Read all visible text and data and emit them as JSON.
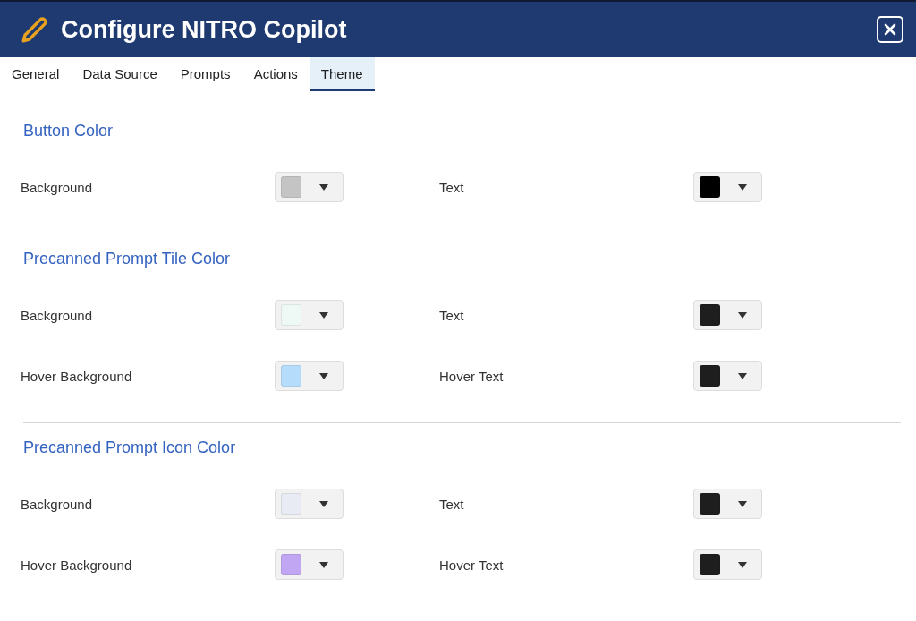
{
  "window": {
    "title": "Configure NITRO Copilot"
  },
  "tabs": [
    {
      "label": "General",
      "selected": false
    },
    {
      "label": "Data Source",
      "selected": false
    },
    {
      "label": "Prompts",
      "selected": false
    },
    {
      "label": "Actions",
      "selected": false
    },
    {
      "label": "Theme",
      "selected": true
    }
  ],
  "sections": [
    {
      "title": "Button Color",
      "rows": [
        [
          {
            "label": "Background",
            "color": "#c4c4c4"
          },
          {
            "label": "Text",
            "color": "#000000"
          }
        ]
      ]
    },
    {
      "title": "Precanned Prompt Tile Color",
      "rows": [
        [
          {
            "label": "Background",
            "color": "#eef8f5"
          },
          {
            "label": "Text",
            "color": "#1e1e1e"
          }
        ],
        [
          {
            "label": "Hover Background",
            "color": "#b5dcfb"
          },
          {
            "label": "Hover Text",
            "color": "#1e1e1e"
          }
        ]
      ]
    },
    {
      "title": "Precanned Prompt Icon Color",
      "rows": [
        [
          {
            "label": "Background",
            "color": "#e8ebf3"
          },
          {
            "label": "Text",
            "color": "#1e1e1e"
          }
        ],
        [
          {
            "label": "Hover Background",
            "color": "#c0a6f3"
          },
          {
            "label": "Hover Text",
            "color": "#1e1e1e"
          }
        ]
      ]
    }
  ]
}
